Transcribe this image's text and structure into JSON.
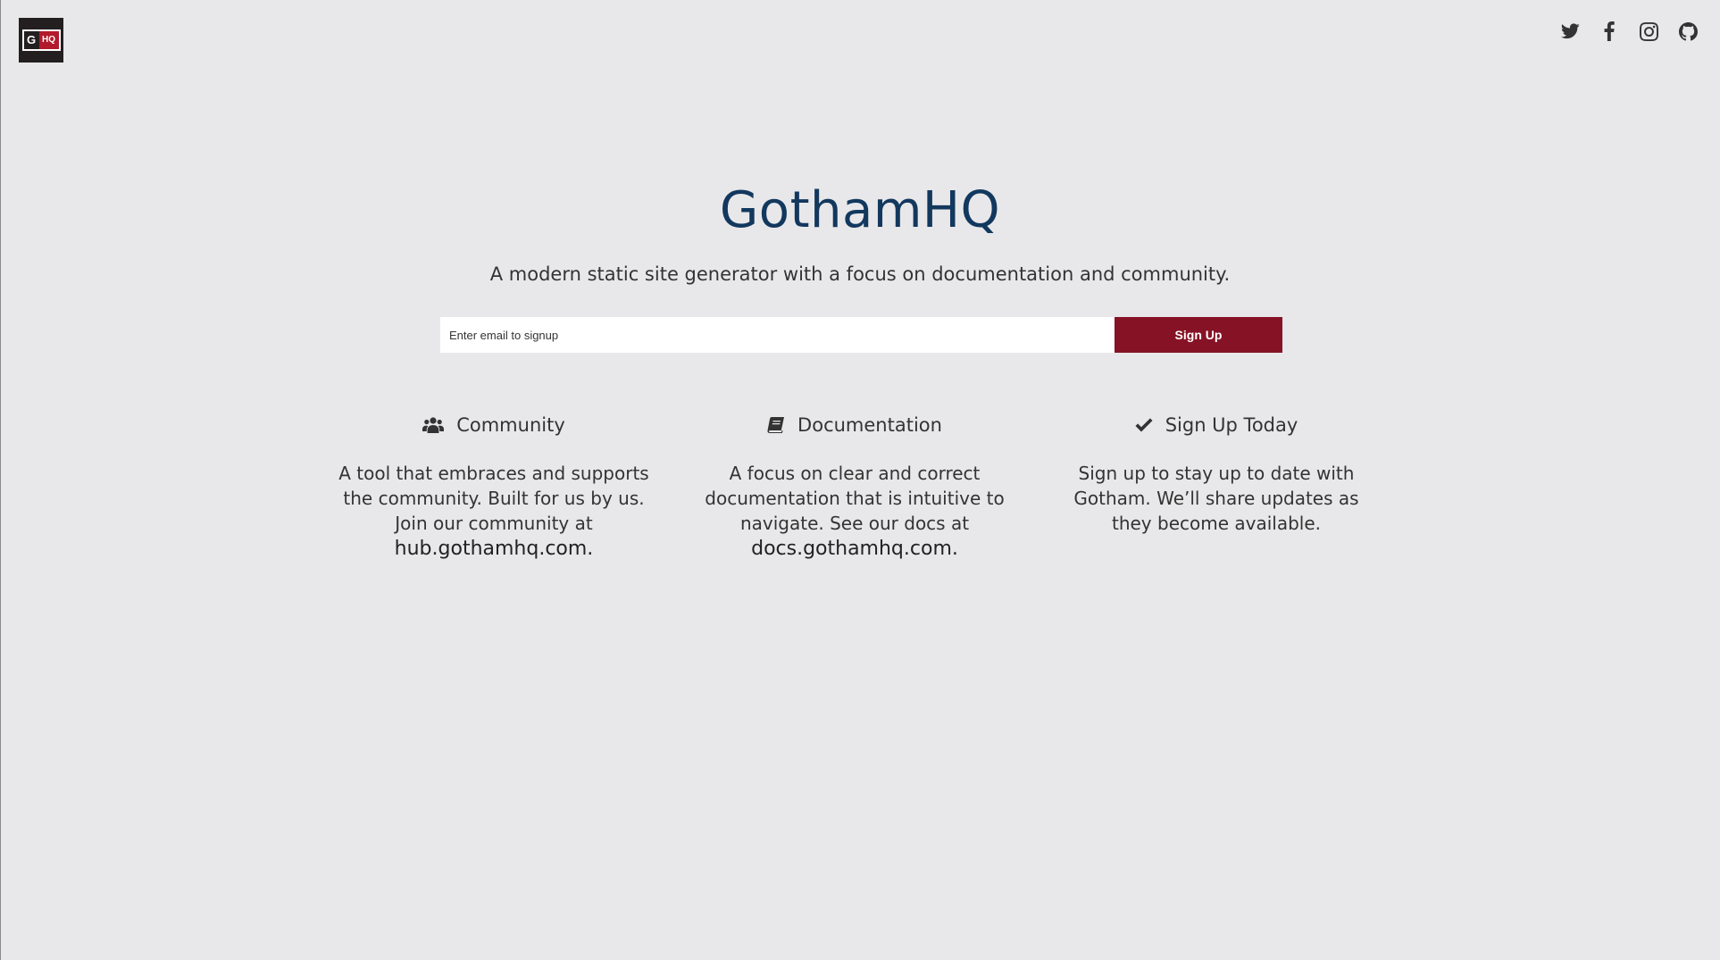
{
  "brand": {
    "logo_letter": "G",
    "logo_badge": "HQ",
    "title": "GothamHQ",
    "tagline": "A modern static site generator with a focus on documentation and community."
  },
  "social": [
    {
      "name": "twitter-icon"
    },
    {
      "name": "facebook-icon"
    },
    {
      "name": "instagram-icon"
    },
    {
      "name": "github-icon"
    }
  ],
  "signup": {
    "placeholder": "Enter email to signup",
    "value": "",
    "button_label": "Sign Up"
  },
  "features": [
    {
      "icon": "users-icon",
      "title": "Community",
      "text": "A tool that embraces and supports the community. Built for us by us. Join our community at",
      "link": "hub.gothamhq.com."
    },
    {
      "icon": "book-icon",
      "title": "Documentation",
      "text": "A focus on clear and correct documentation that is intuitive to navigate. See our docs at",
      "link": "docs.gothamhq.com."
    },
    {
      "icon": "checkmark-icon",
      "title": "Sign Up Today",
      "text": "Sign up to stay up to date with Gotham. We’ll share updates as they become available.",
      "link": ""
    }
  ],
  "colors": {
    "background": "#e8e8ea",
    "title": "#13385e",
    "button": "#861325",
    "logo_badge": "#b3192c"
  }
}
